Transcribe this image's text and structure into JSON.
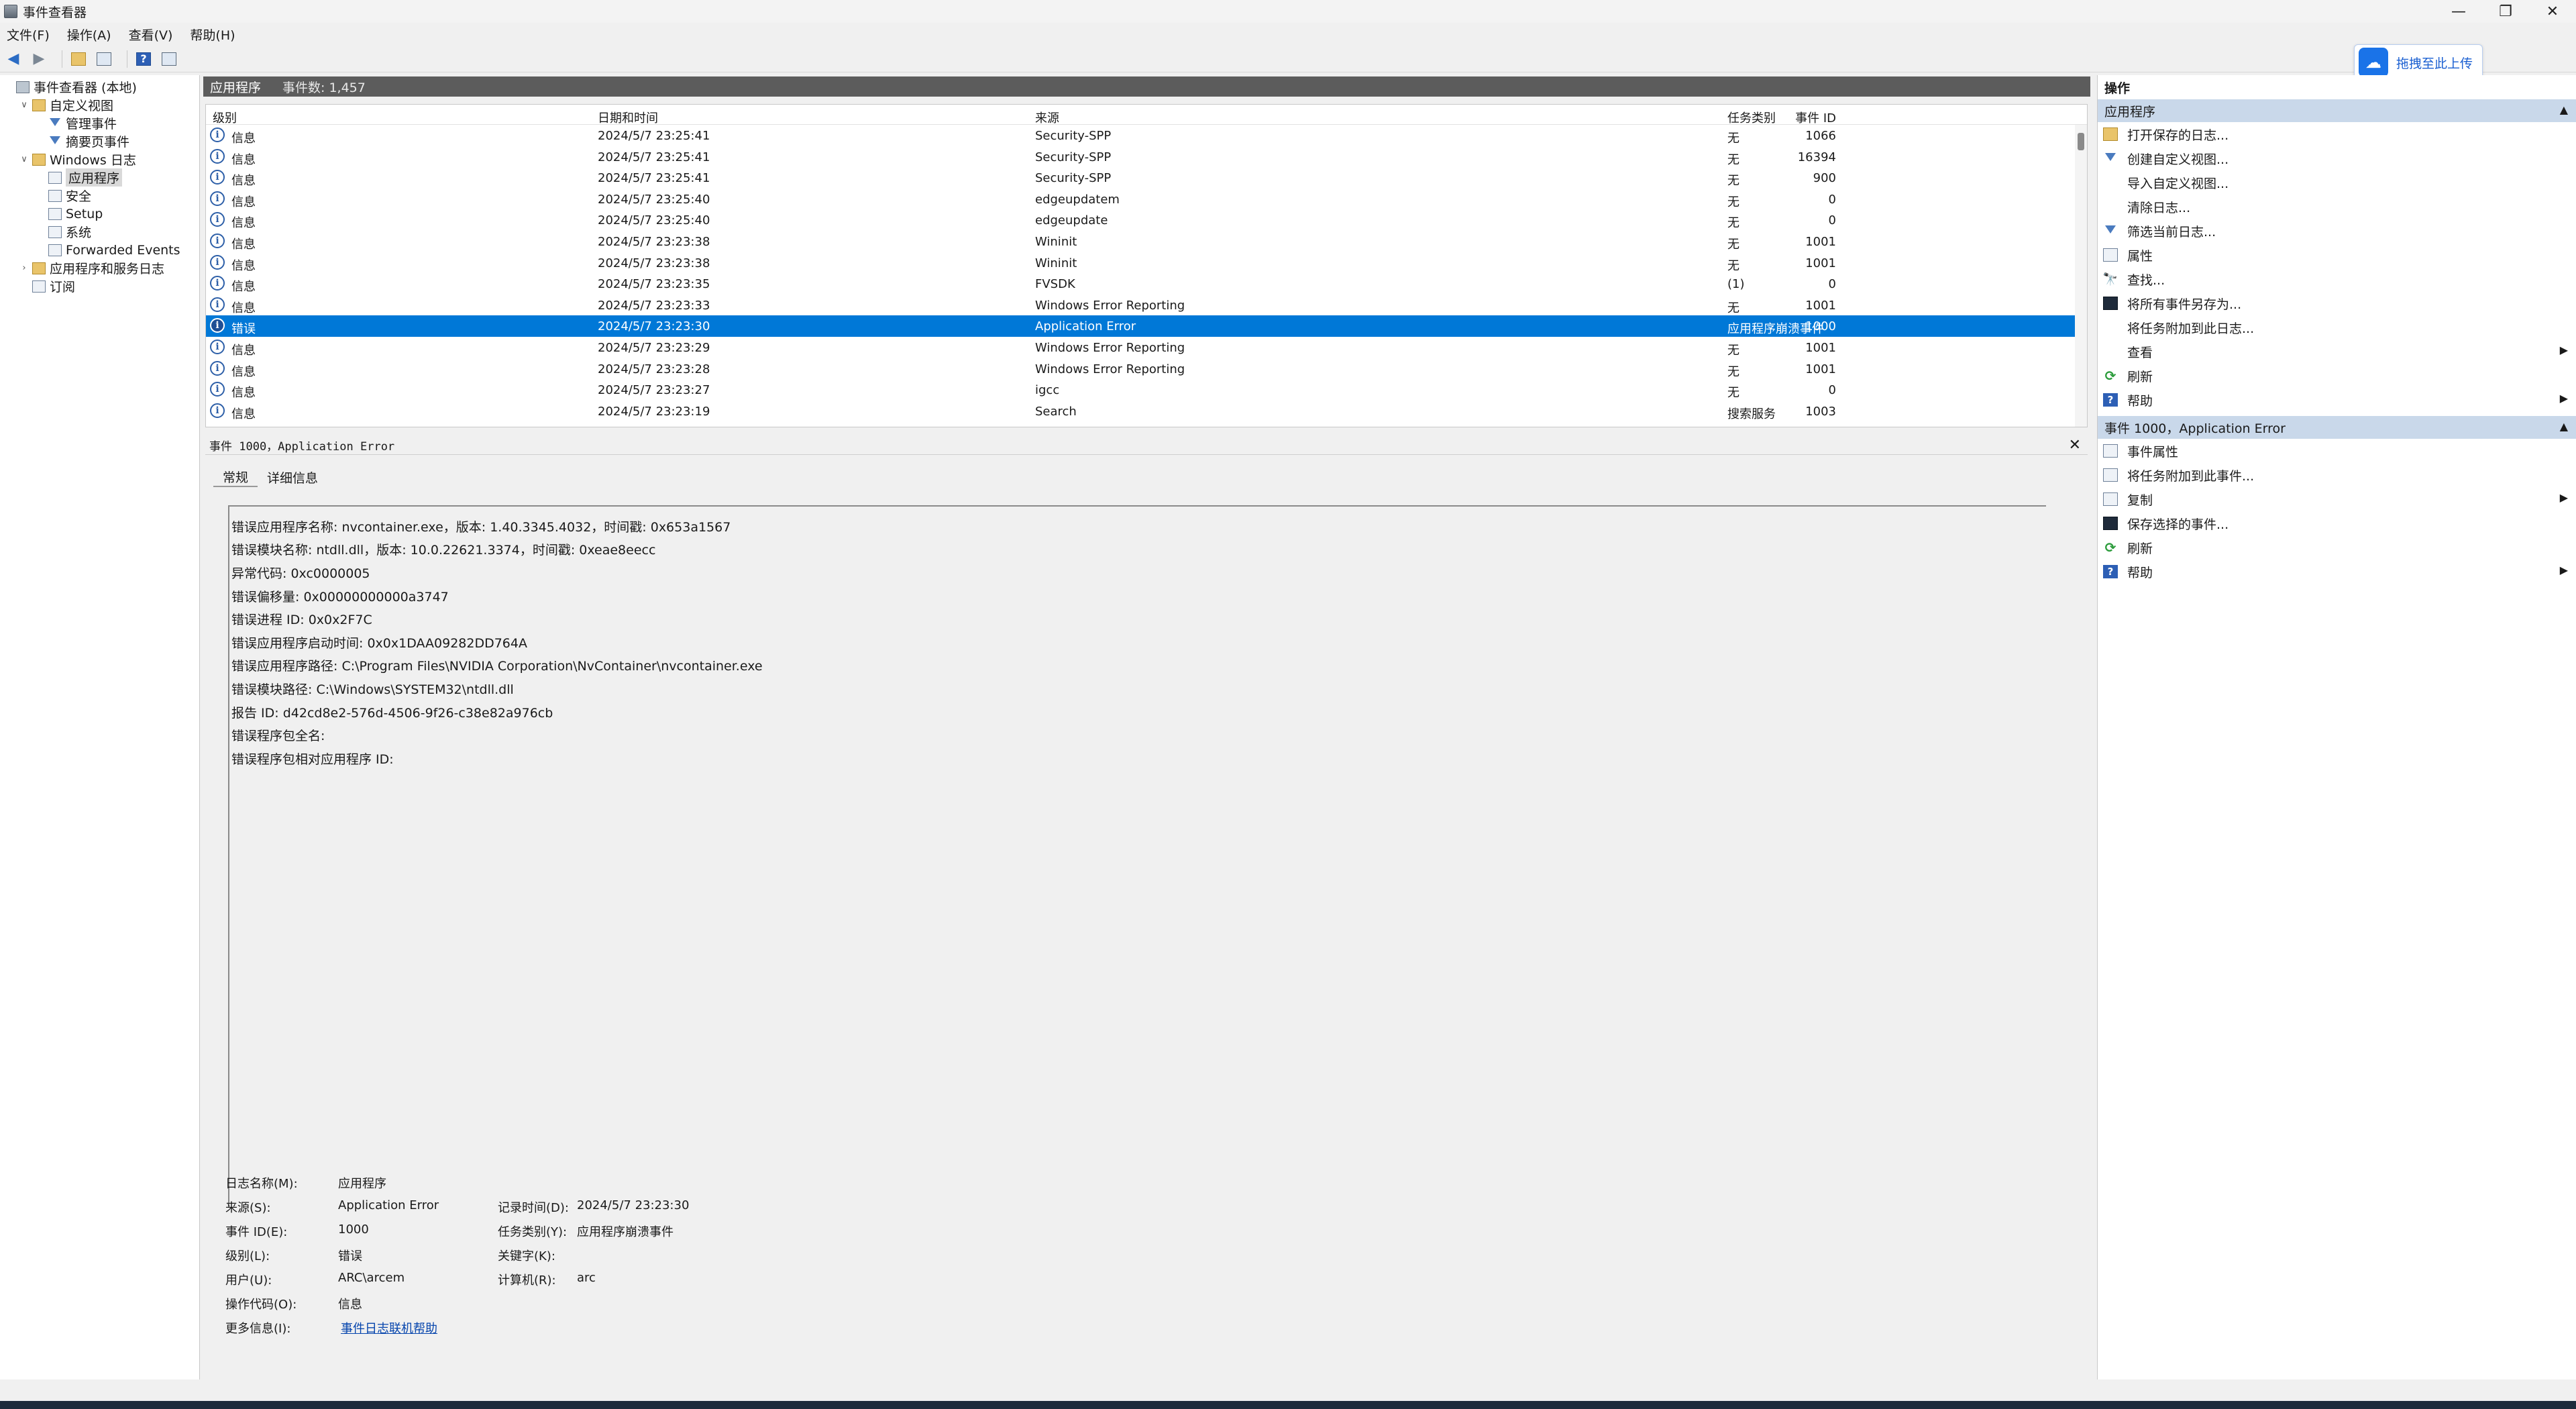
{
  "window": {
    "title": "事件查看器",
    "min": "—",
    "restore": "❐",
    "close": "✕"
  },
  "menu": [
    "文件(F)",
    "操作(A)",
    "查看(V)",
    "帮助(H)"
  ],
  "upload_button": {
    "label": "拖拽至此上传",
    "icon": "cloud-icon"
  },
  "tree": [
    {
      "label": "事件查看器 (本地)",
      "level": 0,
      "arrow": "",
      "icon": "computer"
    },
    {
      "label": "自定义视图",
      "level": 1,
      "arrow": "∨",
      "icon": "folder"
    },
    {
      "label": "管理事件",
      "level": 2,
      "arrow": "",
      "icon": "filter"
    },
    {
      "label": "摘要页事件",
      "level": 2,
      "arrow": "",
      "icon": "filter"
    },
    {
      "label": "Windows 日志",
      "level": 1,
      "arrow": "∨",
      "icon": "folder"
    },
    {
      "label": "应用程序",
      "level": 2,
      "arrow": "",
      "icon": "log",
      "selected": true
    },
    {
      "label": "安全",
      "level": 2,
      "arrow": "",
      "icon": "log"
    },
    {
      "label": "Setup",
      "level": 2,
      "arrow": "",
      "icon": "log"
    },
    {
      "label": "系统",
      "level": 2,
      "arrow": "",
      "icon": "log"
    },
    {
      "label": "Forwarded Events",
      "level": 2,
      "arrow": "",
      "icon": "log"
    },
    {
      "label": "应用程序和服务日志",
      "level": 1,
      "arrow": "›",
      "icon": "folder"
    },
    {
      "label": "订阅",
      "level": 1,
      "arrow": "",
      "icon": "log"
    }
  ],
  "panel": {
    "name": "应用程序",
    "count": "事件数: 1,457"
  },
  "columns": {
    "level": "级别",
    "datetime": "日期和时间",
    "source": "来源",
    "event_id": "事件 ID",
    "task": "任务类别"
  },
  "events": [
    {
      "level": "信息",
      "datetime": "2024/5/7 23:25:41",
      "source": "Security-SPP",
      "event_id": "1066",
      "task": "无"
    },
    {
      "level": "信息",
      "datetime": "2024/5/7 23:25:41",
      "source": "Security-SPP",
      "event_id": "16394",
      "task": "无"
    },
    {
      "level": "信息",
      "datetime": "2024/5/7 23:25:41",
      "source": "Security-SPP",
      "event_id": "900",
      "task": "无"
    },
    {
      "level": "信息",
      "datetime": "2024/5/7 23:25:40",
      "source": "edgeupdatem",
      "event_id": "0",
      "task": "无"
    },
    {
      "level": "信息",
      "datetime": "2024/5/7 23:25:40",
      "source": "edgeupdate",
      "event_id": "0",
      "task": "无"
    },
    {
      "level": "信息",
      "datetime": "2024/5/7 23:23:38",
      "source": "Wininit",
      "event_id": "1001",
      "task": "无"
    },
    {
      "level": "信息",
      "datetime": "2024/5/7 23:23:38",
      "source": "Wininit",
      "event_id": "1001",
      "task": "无"
    },
    {
      "level": "信息",
      "datetime": "2024/5/7 23:23:35",
      "source": "FVSDK",
      "event_id": "0",
      "task": "(1)"
    },
    {
      "level": "信息",
      "datetime": "2024/5/7 23:23:33",
      "source": "Windows Error Reporting",
      "event_id": "1001",
      "task": "无"
    },
    {
      "level": "错误",
      "datetime": "2024/5/7 23:23:30",
      "source": "Application Error",
      "event_id": "1000",
      "task": "应用程序崩溃事件",
      "selected": true
    },
    {
      "level": "信息",
      "datetime": "2024/5/7 23:23:29",
      "source": "Windows Error Reporting",
      "event_id": "1001",
      "task": "无"
    },
    {
      "level": "信息",
      "datetime": "2024/5/7 23:23:28",
      "source": "Windows Error Reporting",
      "event_id": "1001",
      "task": "无"
    },
    {
      "level": "信息",
      "datetime": "2024/5/7 23:23:27",
      "source": "igcc",
      "event_id": "0",
      "task": "无"
    },
    {
      "level": "信息",
      "datetime": "2024/5/7 23:23:19",
      "source": "Search",
      "event_id": "1003",
      "task": "搜索服务"
    }
  ],
  "detail": {
    "title": "事件 1000，Application Error",
    "close": "✕",
    "tabs": [
      "常规",
      "详细信息"
    ],
    "description": [
      "错误应用程序名称: nvcontainer.exe，版本: 1.40.3345.4032，时间戳: 0x653a1567",
      "错误模块名称: ntdll.dll，版本: 10.0.22621.3374，时间戳: 0xeae8eecc",
      "异常代码: 0xc0000005",
      "错误偏移量: 0x00000000000a3747",
      "错误进程 ID: 0x0x2F7C",
      "错误应用程序启动时间: 0x0x1DAA09282DD764A",
      "错误应用程序路径: C:\\Program Files\\NVIDIA Corporation\\NvContainer\\nvcontainer.exe",
      "错误模块路径: C:\\Windows\\SYSTEM32\\ntdll.dll",
      "报告 ID: d42cd8e2-576d-4506-9f26-c38e82a976cb",
      "错误程序包全名:",
      "错误程序包相对应用程序 ID:"
    ],
    "props": {
      "log_name_label": "日志名称(M):",
      "log_name": "应用程序",
      "source_label": "来源(S):",
      "source": "Application Error",
      "logged_label": "记录时间(D):",
      "logged": "2024/5/7 23:23:30",
      "event_id_label": "事件 ID(E):",
      "event_id": "1000",
      "task_label": "任务类别(Y):",
      "task": "应用程序崩溃事件",
      "level_label": "级别(L):",
      "level": "错误",
      "keywords_label": "关键字(K):",
      "keywords": "",
      "user_label": "用户(U):",
      "user": "ARC\\arcem",
      "computer_label": "计算机(R):",
      "computer": "arc",
      "opcode_label": "操作代码(O):",
      "opcode": "信息",
      "more_label": "更多信息(I):",
      "more_link": "事件日志联机帮助"
    }
  },
  "actions": {
    "title": "操作",
    "section1": "应用程序",
    "items1": [
      {
        "label": "打开保存的日志...",
        "icon": "folder"
      },
      {
        "label": "创建自定义视图...",
        "icon": "filter"
      },
      {
        "label": "导入自定义视图...",
        "icon": "blank"
      },
      {
        "label": "清除日志...",
        "icon": "blank"
      },
      {
        "label": "筛选当前日志...",
        "icon": "filter"
      },
      {
        "label": "属性",
        "icon": "doc"
      },
      {
        "label": "查找...",
        "icon": "find"
      },
      {
        "label": "将所有事件另存为...",
        "icon": "save"
      },
      {
        "label": "将任务附加到此日志...",
        "icon": "blank"
      },
      {
        "label": "查看",
        "icon": "blank",
        "sub": true
      },
      {
        "label": "刷新",
        "icon": "refresh"
      },
      {
        "label": "帮助",
        "icon": "help",
        "sub": true
      }
    ],
    "section2": "事件 1000，Application Error",
    "items2": [
      {
        "label": "事件属性",
        "icon": "doc"
      },
      {
        "label": "将任务附加到此事件...",
        "icon": "doc"
      },
      {
        "label": "复制",
        "icon": "doc",
        "sub": true
      },
      {
        "label": "保存选择的事件...",
        "icon": "save"
      },
      {
        "label": "刷新",
        "icon": "refresh"
      },
      {
        "label": "帮助",
        "icon": "help",
        "sub": true
      }
    ]
  },
  "colors": {
    "selection": "#0078d7",
    "header_dark": "#5c5c5c",
    "action_section": "#c9d8ea"
  }
}
